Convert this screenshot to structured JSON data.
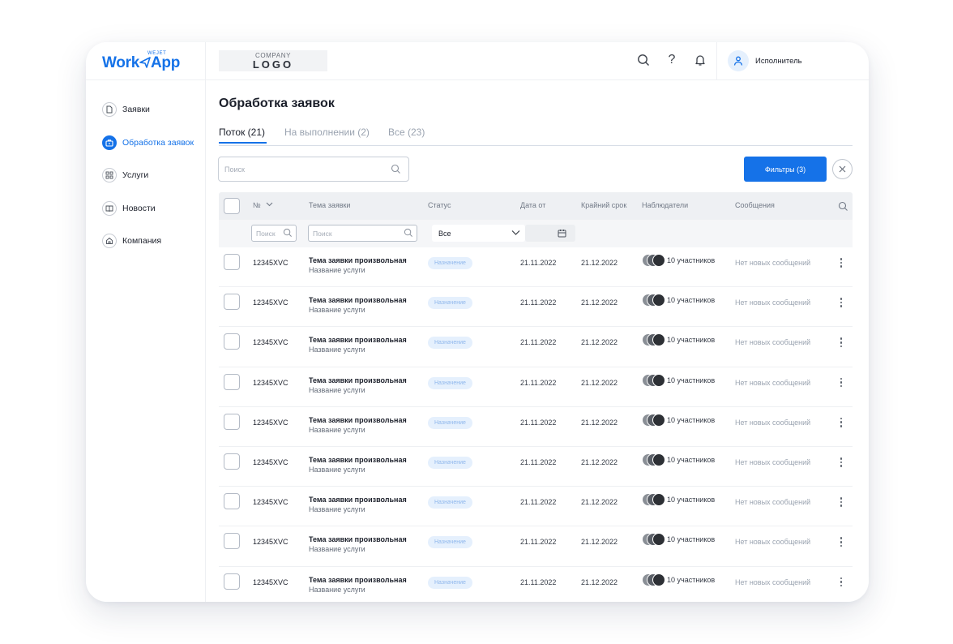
{
  "app": {
    "brand": "Work",
    "brand_app": "App",
    "brand_tag": "WEJET"
  },
  "company_logo": {
    "line1": "COMPANY",
    "line2": "LOGO"
  },
  "sidebar": {
    "items": [
      {
        "label": "Заявки",
        "icon": "document-icon",
        "active": false
      },
      {
        "label": "Обработка заявок",
        "icon": "briefcase-icon",
        "active": true
      },
      {
        "label": "Услуги",
        "icon": "grid-icon",
        "active": false
      },
      {
        "label": "Новости",
        "icon": "book-icon",
        "active": false
      },
      {
        "label": "Компания",
        "icon": "home-icon",
        "active": false
      }
    ]
  },
  "topbar": {
    "help": "?",
    "user_name": "Исполнитель"
  },
  "main": {
    "title": "Обработка заявок",
    "tabs": [
      {
        "label": "Поток (21)",
        "active": true
      },
      {
        "label": "На выполнении (2)",
        "active": false
      },
      {
        "label": "Все (23)",
        "active": false
      }
    ],
    "search_placeholder": "Поиск",
    "filters_button": "Фильтры (3)"
  },
  "table": {
    "columns": {
      "num": "№",
      "topic": "Тема заявки",
      "status": "Статус",
      "date_from": "Дата от",
      "deadline": "Крайний срок",
      "observers": "Наблюдатели",
      "messages": "Сообщения"
    },
    "filters": {
      "num_placeholder": "Поиск",
      "topic_placeholder": "Поиск",
      "status_value": "Все"
    },
    "rows": [
      {
        "num": "12345XVC",
        "topic": "Тема заявки произвольная",
        "service": "Название услуги",
        "status": "Назначение",
        "date_from": "21.11.2022",
        "deadline": "21.12.2022",
        "observers": "10 участников",
        "messages": "Нет новых сообщений"
      },
      {
        "num": "12345XVC",
        "topic": "Тема заявки произвольная",
        "service": "Название услуги",
        "status": "Назначение",
        "date_from": "21.11.2022",
        "deadline": "21.12.2022",
        "observers": "10 участников",
        "messages": "Нет новых сообщений"
      },
      {
        "num": "12345XVC",
        "topic": "Тема заявки произвольная",
        "service": "Название услуги",
        "status": "Назначение",
        "date_from": "21.11.2022",
        "deadline": "21.12.2022",
        "observers": "10 участников",
        "messages": "Нет новых сообщений"
      },
      {
        "num": "12345XVC",
        "topic": "Тема заявки произвольная",
        "service": "Название услуги",
        "status": "Назначение",
        "date_from": "21.11.2022",
        "deadline": "21.12.2022",
        "observers": "10 участников",
        "messages": "Нет новых сообщений"
      },
      {
        "num": "12345XVC",
        "topic": "Тема заявки произвольная",
        "service": "Название услуги",
        "status": "Назначение",
        "date_from": "21.11.2022",
        "deadline": "21.12.2022",
        "observers": "10 участников",
        "messages": "Нет новых сообщений"
      },
      {
        "num": "12345XVC",
        "topic": "Тема заявки произвольная",
        "service": "Название услуги",
        "status": "Назначение",
        "date_from": "21.11.2022",
        "deadline": "21.12.2022",
        "observers": "10 участников",
        "messages": "Нет новых сообщений"
      },
      {
        "num": "12345XVC",
        "topic": "Тема заявки произвольная",
        "service": "Название услуги",
        "status": "Назначение",
        "date_from": "21.11.2022",
        "deadline": "21.12.2022",
        "observers": "10 участников",
        "messages": "Нет новых сообщений"
      },
      {
        "num": "12345XVC",
        "topic": "Тема заявки произвольная",
        "service": "Название услуги",
        "status": "Назначение",
        "date_from": "21.11.2022",
        "deadline": "21.12.2022",
        "observers": "10 участников",
        "messages": "Нет новых сообщений"
      },
      {
        "num": "12345XVC",
        "topic": "Тема заявки произвольная",
        "service": "Название услуги",
        "status": "Назначение",
        "date_from": "21.11.2022",
        "deadline": "21.12.2022",
        "observers": "10 участников",
        "messages": "Нет новых сообщений"
      }
    ]
  },
  "colors": {
    "accent": "#1572e8",
    "badge_bg": "#e5f0fd",
    "badge_text": "#8fb7ec",
    "header_bg": "#eef0f3"
  }
}
